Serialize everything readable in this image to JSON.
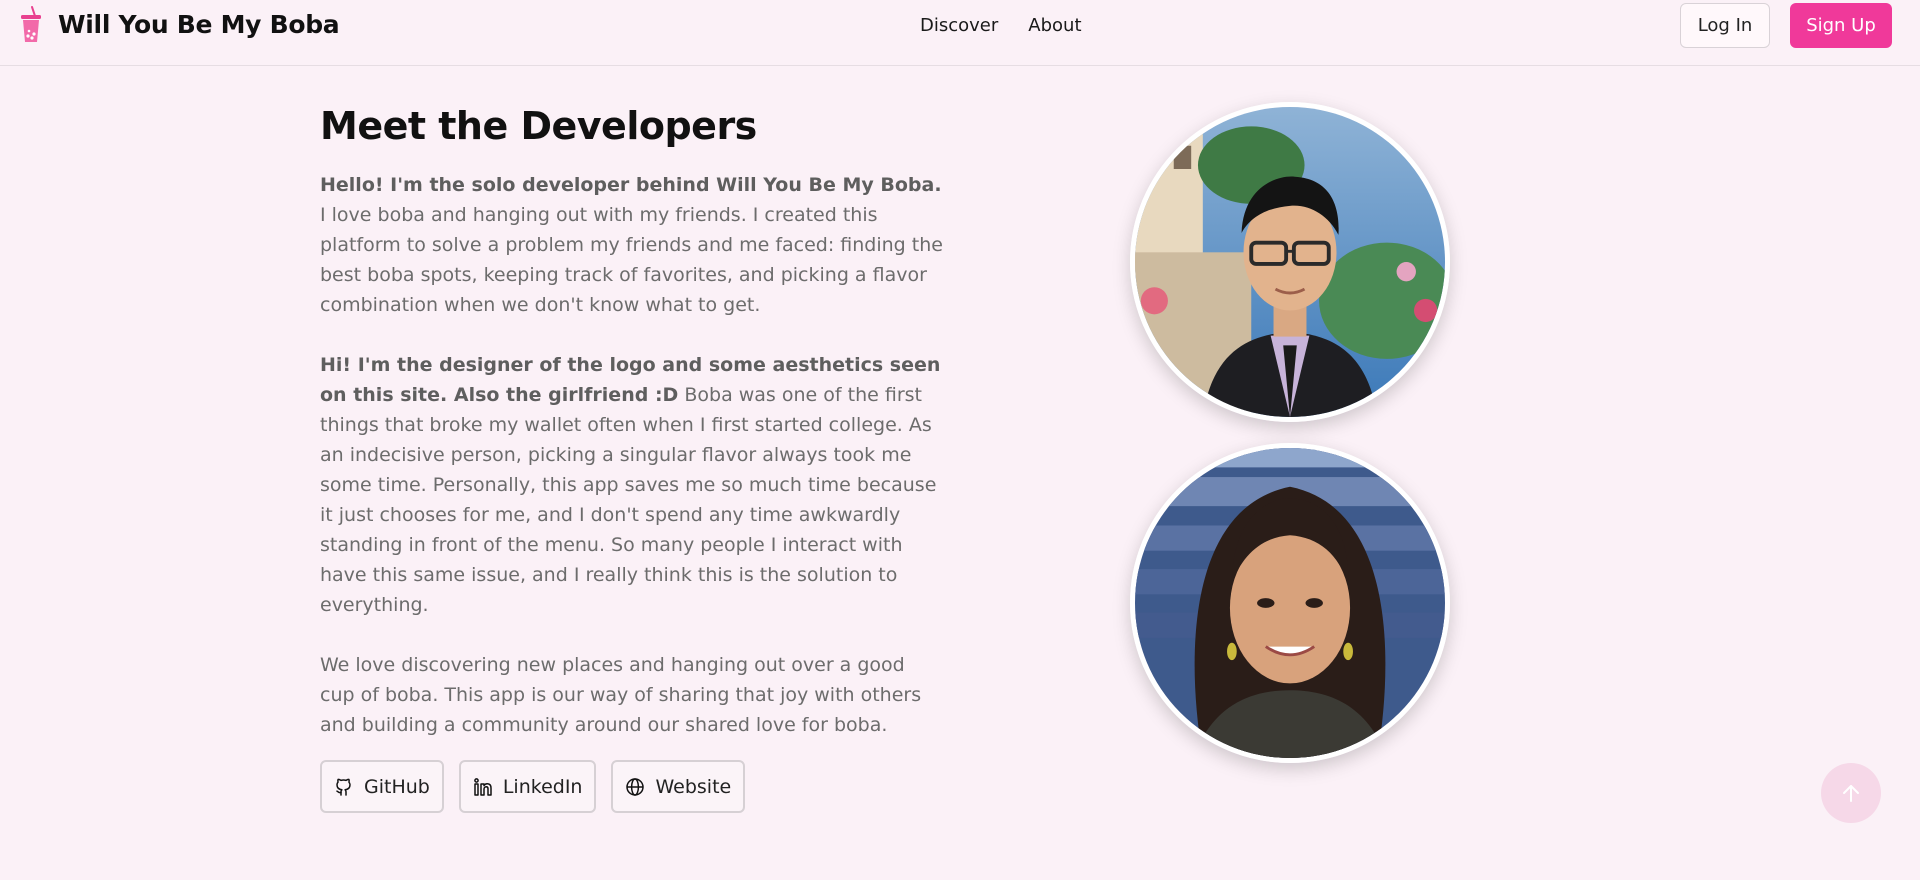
{
  "header": {
    "app_name": "Will You Be My Boba",
    "logo_icon": "boba-cup-icon",
    "nav": [
      {
        "label": "Discover"
      },
      {
        "label": "About"
      }
    ],
    "login_label": "Log In",
    "signup_label": "Sign Up",
    "accent_color": "#f0399a"
  },
  "main": {
    "title": "Meet the Developers",
    "paragraphs": [
      {
        "bold": "Hello! I'm the solo developer behind Will You Be My Boba.",
        "text": " I love boba and hanging out with my friends. I created this platform to solve a problem my friends and me faced: finding the best boba spots, keeping track of favorites, and picking a flavor combination when we don't know what to get."
      },
      {
        "bold": "Hi! I'm the designer of the logo and some aesthetics seen on this site. Also the girlfriend :D",
        "text": " Boba was one of the first things that broke my wallet often when I first started college. As an indecisive person, picking a singular flavor always took me some time. Personally, this app saves me so much time because it just chooses for me, and I don't spend any time awkwardly standing in front of the menu. So many people I interact with have this same issue, and I really think this is the solution to everything."
      },
      {
        "bold": "",
        "text": "We love discovering new places and hanging out over a good cup of boba. This app is our way of sharing that joy with others and building a community around our shared love for boba."
      }
    ],
    "links": [
      {
        "label": "GitHub",
        "icon": "github-icon"
      },
      {
        "label": "LinkedIn",
        "icon": "linkedin-icon"
      },
      {
        "label": "Website",
        "icon": "globe-icon"
      }
    ]
  },
  "photos": [
    {
      "icon": "developer-photo"
    },
    {
      "icon": "designer-photo"
    }
  ],
  "scroll_top": {
    "icon": "arrow-up-icon"
  }
}
